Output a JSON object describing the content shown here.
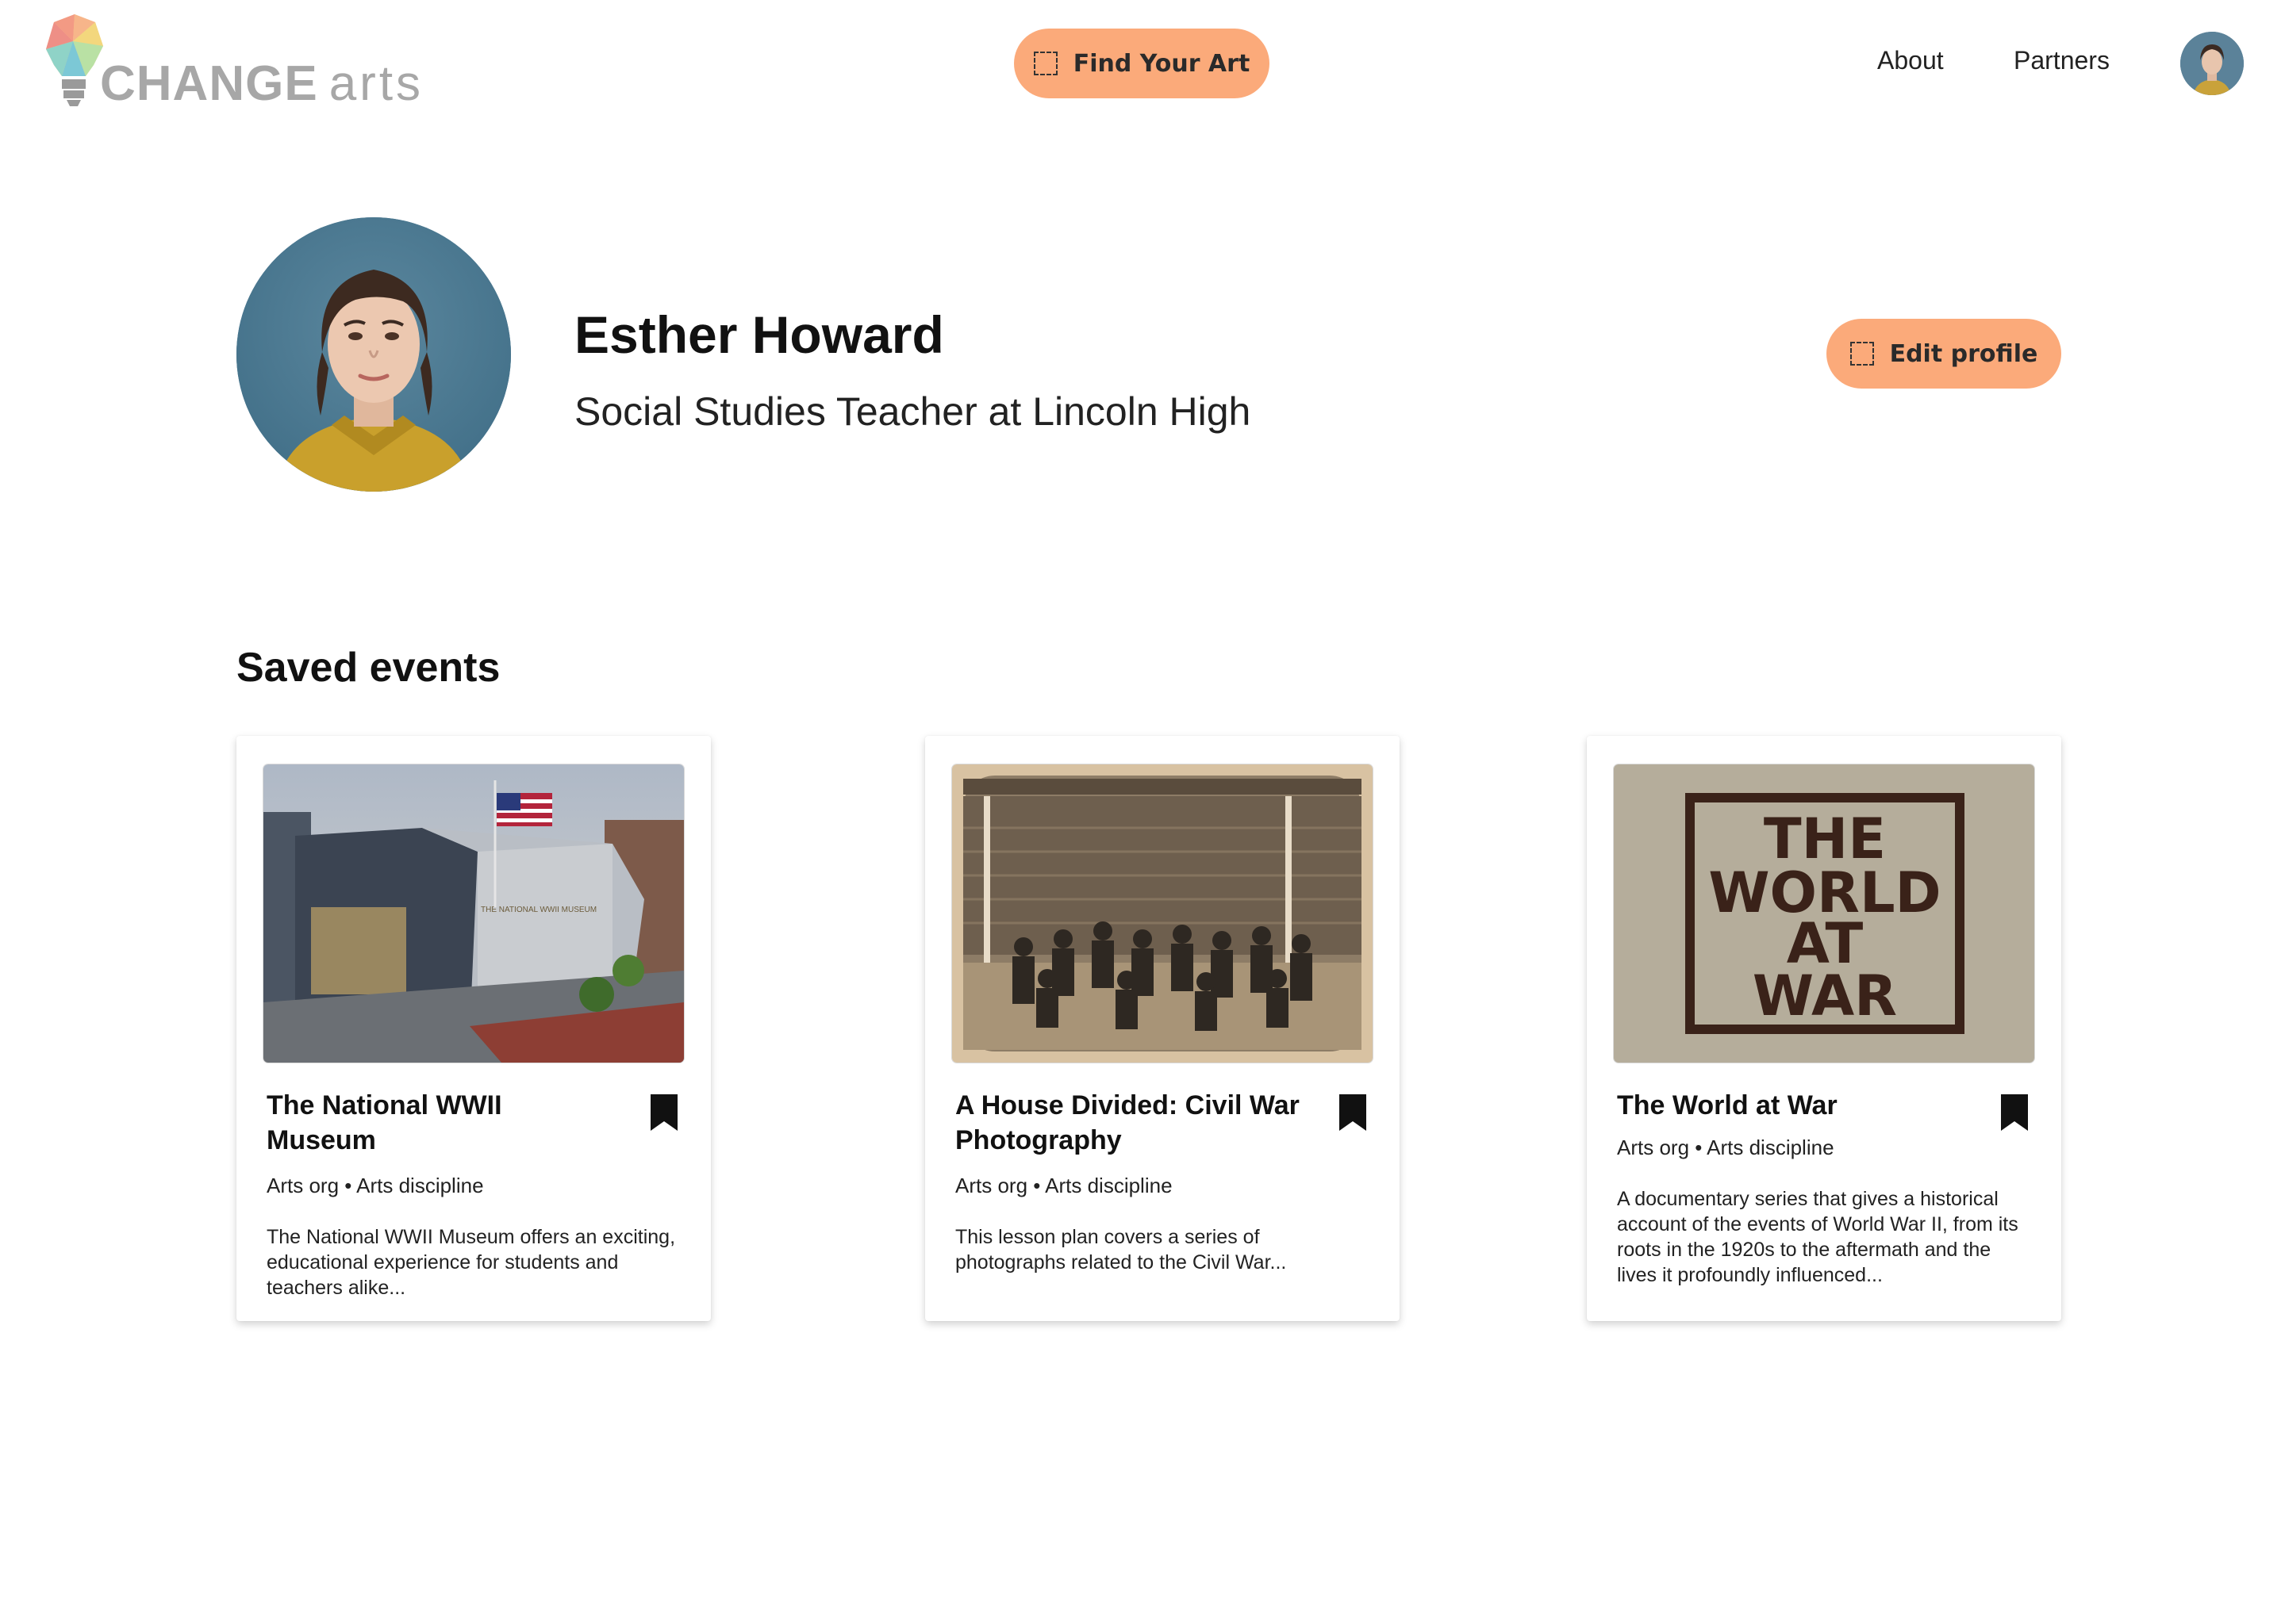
{
  "header": {
    "logo_text_main": "CHANGE",
    "logo_text_sub": "arts",
    "find_button": "Find Your Art",
    "nav": [
      "About",
      "Partners"
    ]
  },
  "profile": {
    "name": "Esther Howard",
    "title": "Social Studies Teacher at Lincoln High",
    "edit_button": "Edit profile"
  },
  "saved": {
    "heading": "Saved events",
    "cards": [
      {
        "title": "The National WWII Museum",
        "meta": "Arts org • Arts discipline",
        "description": "The National WWII Museum offers an exciting, educational experience for students and teachers alike...",
        "image_sign": "THE NATIONAL WWII MUSEUM"
      },
      {
        "title": "A House Divided: Civil War Photography",
        "meta": "Arts org • Arts discipline",
        "description": "This lesson plan covers a series of photographs related to the Civil War..."
      },
      {
        "title": "The World at War",
        "meta": "Arts org • Arts discipline",
        "description": "A documentary series that gives a historical account of the events of World War II, from its roots in the 1920s to the aftermath and the lives it profoundly influenced...",
        "image_lines": [
          "THE",
          "WORLD",
          "AT",
          "WAR"
        ]
      }
    ]
  },
  "colors": {
    "accent": "#fbaa7a",
    "text": "#111111",
    "logo_gray": "#a7a7a7"
  },
  "icons": [
    "logo-bulb-icon",
    "dashed-square-icon",
    "bookmark-icon"
  ]
}
